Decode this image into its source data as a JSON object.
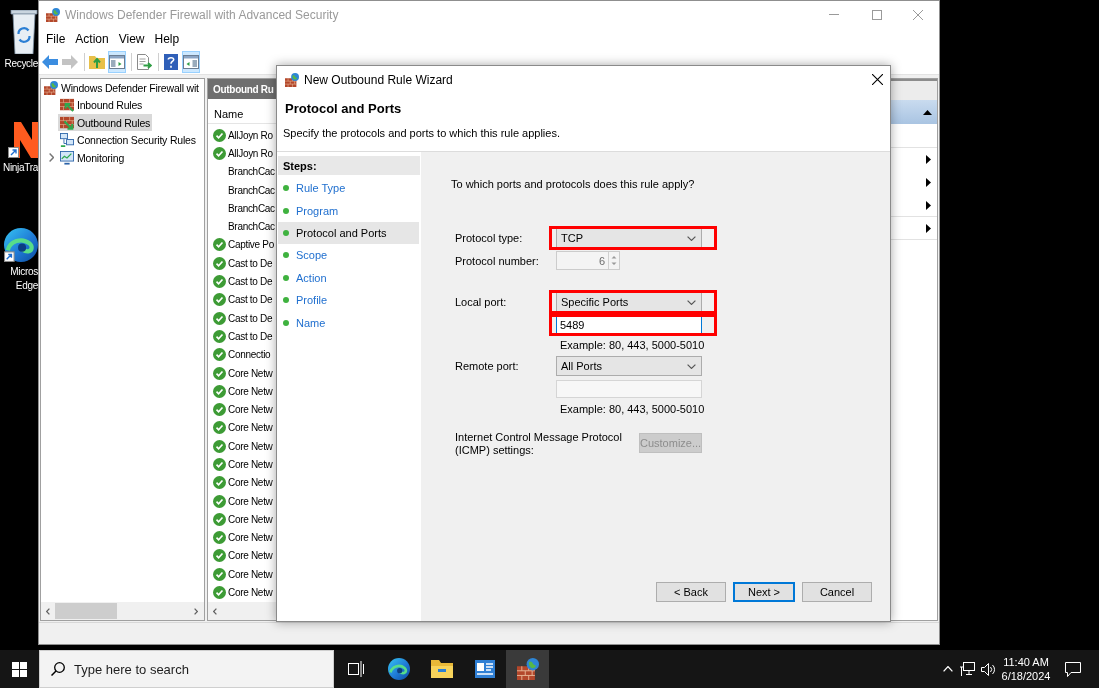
{
  "desktop_icons": [
    {
      "kind": "recycle-bin",
      "label_lines": [
        "Recycle"
      ]
    },
    {
      "kind": "ninja",
      "label_lines": [
        "NinjaTra"
      ]
    },
    {
      "kind": "edge",
      "label_lines": [
        "Micros",
        "Edge"
      ]
    }
  ],
  "window": {
    "title": "Windows Defender Firewall with Advanced Security",
    "active": false
  },
  "menu": [
    "File",
    "Action",
    "View",
    "Help"
  ],
  "toolbar": [
    [
      {
        "kind": "back",
        "disabled": false,
        "pressed": false
      },
      {
        "kind": "forward",
        "disabled": true,
        "pressed": false
      }
    ],
    [
      {
        "kind": "up",
        "disabled": false,
        "pressed": false
      },
      {
        "kind": "console-tree",
        "disabled": false,
        "pressed": true
      }
    ],
    [
      {
        "kind": "export",
        "disabled": false,
        "pressed": false
      }
    ],
    [
      {
        "kind": "help",
        "disabled": false,
        "pressed": false
      },
      {
        "kind": "action-pane",
        "disabled": false,
        "pressed": true
      }
    ]
  ],
  "tree": [
    {
      "label": "Windows Defender Firewall wit",
      "kind": "firewall",
      "selected": false,
      "children": [
        {
          "label": "Inbound Rules",
          "kind": "inbound",
          "selected": false
        },
        {
          "label": "Outbound Rules",
          "kind": "outbound",
          "selected": true
        },
        {
          "label": "Connection Security Rules",
          "kind": "connection",
          "selected": false
        },
        {
          "label": "Monitoring",
          "kind": "monitoring",
          "selected": false,
          "expanded": false
        }
      ]
    }
  ],
  "rules_pane": {
    "title": "Outbound Ru",
    "columns": [
      "Name"
    ],
    "rows": [
      {
        "name": "AllJoyn Ro",
        "enabled": true
      },
      {
        "name": "AllJoyn Ro",
        "enabled": true
      },
      {
        "name": "BranchCac",
        "enabled": false
      },
      {
        "name": "BranchCac",
        "enabled": false
      },
      {
        "name": "BranchCac",
        "enabled": false
      },
      {
        "name": "BranchCac",
        "enabled": false
      },
      {
        "name": "Captive Po",
        "enabled": true
      },
      {
        "name": "Cast to De",
        "enabled": true
      },
      {
        "name": "Cast to De",
        "enabled": true
      },
      {
        "name": "Cast to De",
        "enabled": true
      },
      {
        "name": "Cast to De",
        "enabled": true
      },
      {
        "name": "Cast to De",
        "enabled": true
      },
      {
        "name": "Connectio",
        "enabled": true
      },
      {
        "name": "Core Netw",
        "enabled": true
      },
      {
        "name": "Core Netw",
        "enabled": true
      },
      {
        "name": "Core Netw",
        "enabled": true
      },
      {
        "name": "Core Netw",
        "enabled": true
      },
      {
        "name": "Core Netw",
        "enabled": true
      },
      {
        "name": "Core Netw",
        "enabled": true
      },
      {
        "name": "Core Netw",
        "enabled": true
      },
      {
        "name": "Core Netw",
        "enabled": true
      },
      {
        "name": "Core Netw",
        "enabled": true
      },
      {
        "name": "Core Netw",
        "enabled": true
      },
      {
        "name": "Core Netw",
        "enabled": true
      },
      {
        "name": "Core Netw",
        "enabled": true
      },
      {
        "name": "Core Netw",
        "enabled": true
      }
    ]
  },
  "actions_pane": {
    "expanded": true,
    "items": [
      {
        "kind": "plain",
        "separator_after": true
      },
      {
        "kind": "submenu",
        "separator_after": false
      },
      {
        "kind": "submenu",
        "separator_after": false
      },
      {
        "kind": "submenu",
        "separator_after": true
      },
      {
        "kind": "submenu",
        "separator_after": true
      }
    ]
  },
  "dialog": {
    "title": "New Outbound Rule Wizard",
    "heading": "Protocol and Ports",
    "subtitle": "Specify the protocols and ports to which this rule applies.",
    "steps_title": "Steps:",
    "steps": [
      {
        "label": "Rule Type",
        "selected": false
      },
      {
        "label": "Program",
        "selected": false
      },
      {
        "label": "Protocol and Ports",
        "selected": true
      },
      {
        "label": "Scope",
        "selected": false
      },
      {
        "label": "Action",
        "selected": false
      },
      {
        "label": "Profile",
        "selected": false
      },
      {
        "label": "Name",
        "selected": false
      }
    ],
    "question": "To which ports and protocols does this rule apply?",
    "fields": [
      {
        "kind": "combo",
        "label": "Protocol type:",
        "value": "TCP",
        "highlighted": true
      },
      {
        "kind": "spinner",
        "label": "Protocol number:",
        "value": "6",
        "disabled": true,
        "highlighted": false
      },
      {
        "kind": "combo",
        "label": "Local port:",
        "value": "Specific Ports",
        "highlighted": true
      },
      {
        "kind": "text",
        "value": "5489",
        "disabled": false,
        "focused": true,
        "highlighted": true
      },
      {
        "kind": "hint",
        "text": "Example: 80, 443, 5000-5010"
      },
      {
        "kind": "combo",
        "label": "Remote port:",
        "value": "All Ports",
        "highlighted": false
      },
      {
        "kind": "text",
        "disabled": true,
        "focused": false,
        "highlighted": false
      },
      {
        "kind": "hint",
        "text": "Example: 80, 443, 5000-5010"
      },
      {
        "kind": "button",
        "label": "Internet Control Message Protocol (ICMP) settings:",
        "button": "Customize...",
        "disabled": true
      }
    ],
    "buttons": [
      {
        "kind": "back",
        "label": "< Back",
        "default": false
      },
      {
        "kind": "next",
        "label": "Next >",
        "default": true
      },
      {
        "kind": "cancel",
        "label": "Cancel",
        "default": false
      }
    ]
  },
  "taskbar": {
    "search": {
      "placeholder": "Type here to search"
    },
    "apps": [
      {
        "kind": "task-view",
        "active": false
      },
      {
        "kind": "edge",
        "active": false
      },
      {
        "kind": "explorer",
        "active": false
      },
      {
        "kind": "server-manager",
        "active": false
      },
      {
        "kind": "firewall",
        "active": true
      }
    ],
    "time": "11:40 AM",
    "date": "6/18/2024"
  }
}
